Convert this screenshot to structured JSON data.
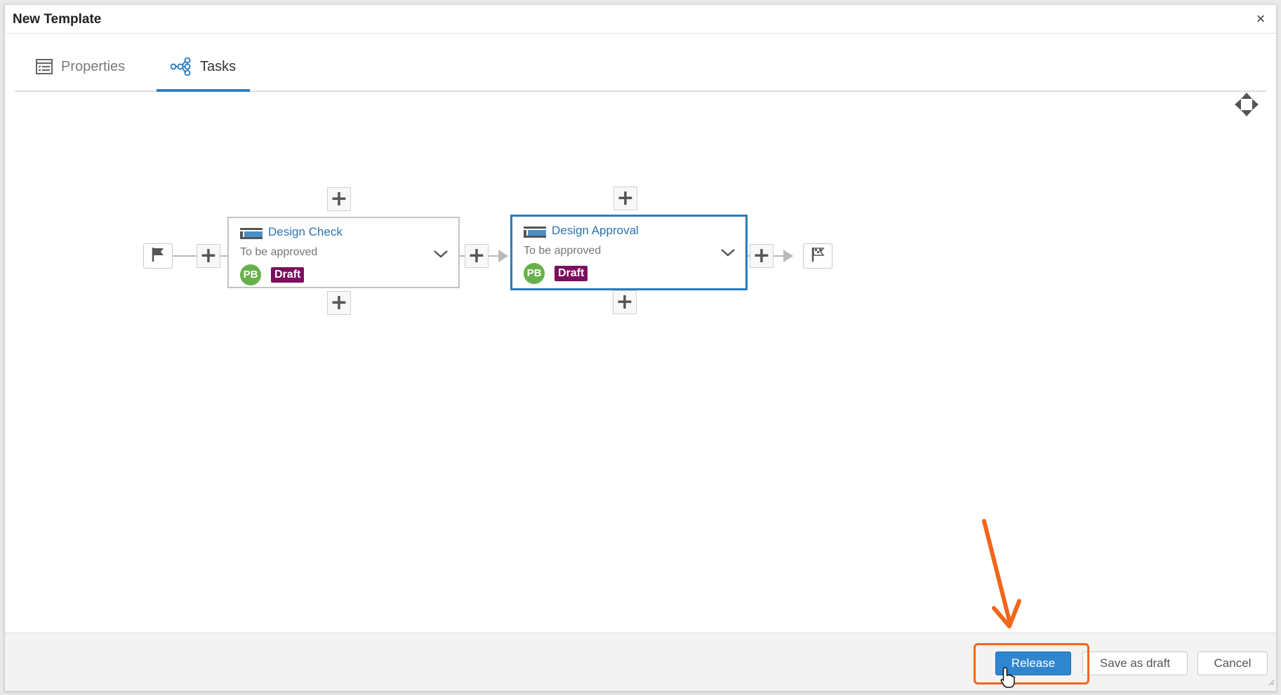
{
  "dialog": {
    "title": "New Template",
    "close_icon": "close-icon"
  },
  "tabs": [
    {
      "label": "Properties",
      "icon": "list-icon",
      "active": false
    },
    {
      "label": "Tasks",
      "icon": "workflow-icon",
      "active": true
    }
  ],
  "workflow": {
    "start_icon": "start-flag-icon",
    "end_icon": "end-flag-icon",
    "tasks": [
      {
        "name": "Design Check",
        "status": "To be approved",
        "assignee_initials": "PB",
        "badge": "Draft",
        "selected": false
      },
      {
        "name": "Design Approval",
        "status": "To be approved",
        "assignee_initials": "PB",
        "badge": "Draft",
        "selected": true
      }
    ]
  },
  "footer": {
    "release_label": "Release",
    "save_draft_label": "Save as draft",
    "cancel_label": "Cancel"
  },
  "colors": {
    "accent": "#2f7fbf",
    "task_title": "#2a73b2",
    "avatar": "#68b04b",
    "draft_badge": "#7b0f5e",
    "release_button": "#2f86cf",
    "annotation": "#f2661a"
  }
}
